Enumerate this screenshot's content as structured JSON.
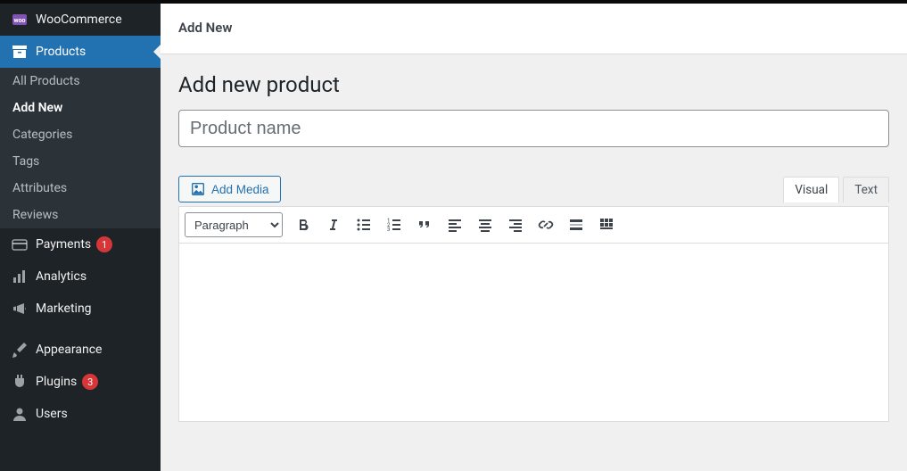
{
  "sidebar": {
    "woocommerce": "WooCommerce",
    "products": "Products",
    "products_sub": [
      {
        "label": "All Products",
        "current": false
      },
      {
        "label": "Add New",
        "current": true
      },
      {
        "label": "Categories",
        "current": false
      },
      {
        "label": "Tags",
        "current": false
      },
      {
        "label": "Attributes",
        "current": false
      },
      {
        "label": "Reviews",
        "current": false
      }
    ],
    "payments": {
      "label": "Payments",
      "badge": "1"
    },
    "analytics": "Analytics",
    "marketing": "Marketing",
    "appearance": "Appearance",
    "plugins": {
      "label": "Plugins",
      "badge": "3"
    },
    "users": "Users"
  },
  "header": {
    "title": "Add New"
  },
  "page": {
    "title": "Add new product",
    "name_placeholder": "Product name"
  },
  "editor": {
    "add_media": "Add Media",
    "tabs": {
      "visual": "Visual",
      "text": "Text"
    },
    "format_current": "Paragraph"
  }
}
